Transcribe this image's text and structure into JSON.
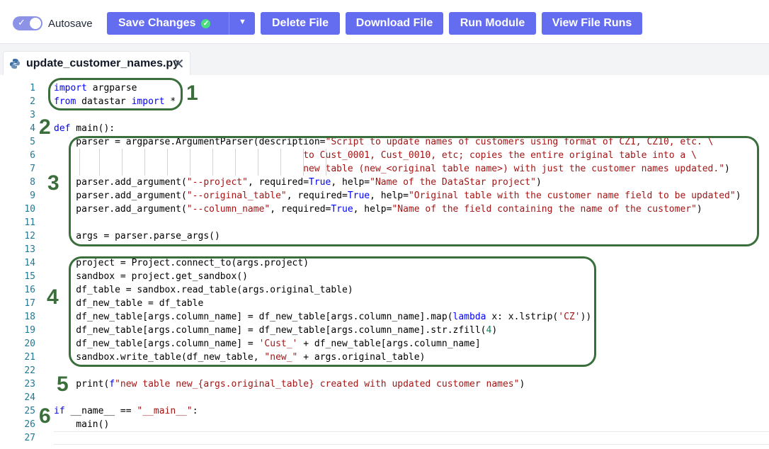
{
  "toolbar": {
    "autosave_label": "Autosave",
    "save_label": "Save Changes",
    "delete_label": "Delete File",
    "download_label": "Download File",
    "run_label": "Run Module",
    "runs_label": "View File Runs"
  },
  "tab": {
    "filename": "update_customer_names.py"
  },
  "colors": {
    "button": "#646df0",
    "annotation": "#3a6e3a",
    "keyword": "#0000ff",
    "string": "#a31515",
    "line_number": "#237893"
  },
  "editor": {
    "line_numbers": [
      "1",
      "2",
      "3",
      "4",
      "5",
      "6",
      "7",
      "8",
      "9",
      "10",
      "11",
      "12",
      "13",
      "14",
      "15",
      "16",
      "17",
      "18",
      "19",
      "20",
      "21",
      "22",
      "23",
      "24",
      "25",
      "26",
      "27"
    ]
  },
  "annotations": [
    "1",
    "2",
    "3",
    "4",
    "5",
    "6"
  ]
}
